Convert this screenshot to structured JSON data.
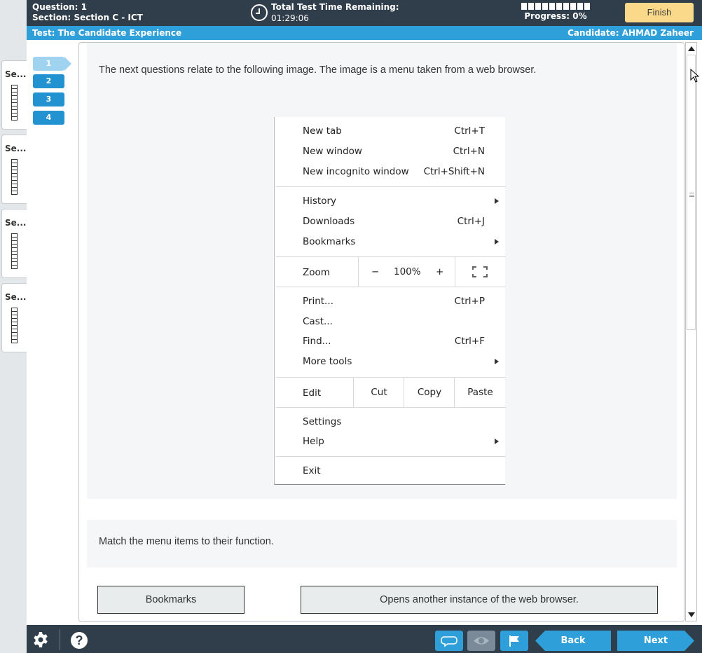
{
  "header": {
    "question_label": "Question: 1",
    "section_label": "Section: Section C - ICT",
    "timer_title": "Total Test Time Remaining:",
    "timer_value": "01:29:06",
    "progress_label": "Progress: 0%",
    "progress_value": 0,
    "finish_label": "Finish"
  },
  "subheader": {
    "test_label": "Test: The Candidate Experience",
    "candidate_label": "Candidate: AHMAD Zaheer"
  },
  "sections": [
    {
      "label": "Se..."
    },
    {
      "label": "Se..."
    },
    {
      "label": "Se..."
    },
    {
      "label": "Se..."
    }
  ],
  "questions": [
    {
      "label": "1"
    },
    {
      "label": "2"
    },
    {
      "label": "3"
    },
    {
      "label": "4"
    }
  ],
  "stem_text": "The next questions relate to the following image. The image is a menu taken from a web browser.",
  "browser_menu": {
    "items1": [
      {
        "name": "New tab",
        "shortcut": "Ctrl+T"
      },
      {
        "name": "New window",
        "shortcut": "Ctrl+N"
      },
      {
        "name": "New incognito window",
        "shortcut": "Ctrl+Shift+N"
      }
    ],
    "items2": [
      {
        "name": "History",
        "shortcut": ""
      },
      {
        "name": "Downloads",
        "shortcut": "Ctrl+J"
      },
      {
        "name": "Bookmarks",
        "shortcut": ""
      }
    ],
    "zoom": {
      "label": "Zoom",
      "minus": "−",
      "value": "100%",
      "plus": "+"
    },
    "items3": [
      {
        "name": "Print...",
        "shortcut": "Ctrl+P"
      },
      {
        "name": "Cast...",
        "shortcut": ""
      },
      {
        "name": "Find...",
        "shortcut": "Ctrl+F"
      },
      {
        "name": "More tools",
        "shortcut": ""
      }
    ],
    "edit": {
      "label": "Edit",
      "cut": "Cut",
      "copy": "Copy",
      "paste": "Paste"
    },
    "items4": [
      {
        "name": "Settings",
        "shortcut": ""
      },
      {
        "name": "Help",
        "shortcut": ""
      }
    ],
    "exit": "Exit"
  },
  "instruction_text": "Match the menu items to their function.",
  "options": {
    "left": "Bookmarks",
    "right": "Opens another instance of the web browser."
  },
  "footer": {
    "back_label": "Back",
    "next_label": "Next",
    "help_glyph": "?"
  }
}
